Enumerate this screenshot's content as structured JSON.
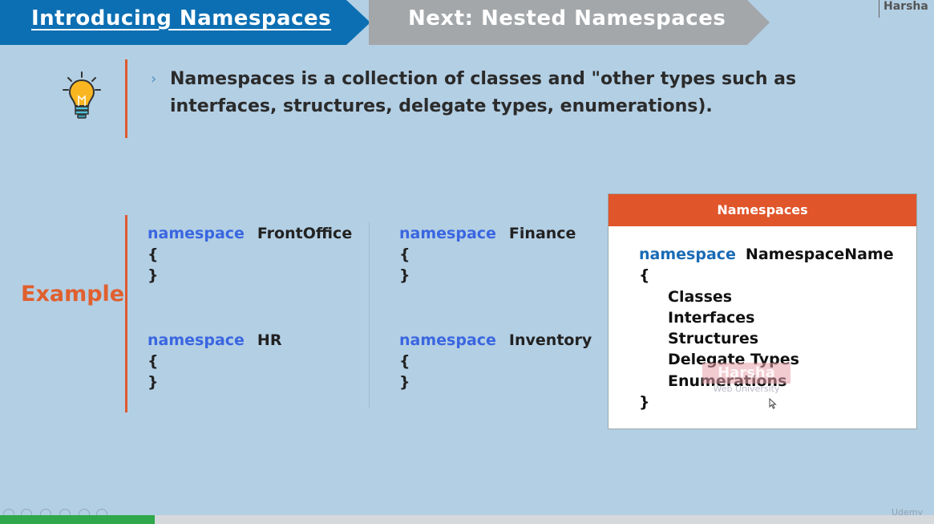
{
  "header": {
    "current_title": "Introducing Namespaces",
    "next_title": "Next: Nested Namespaces",
    "author": "Harsha"
  },
  "intro": {
    "text": "Namespaces is a collection of classes and \"other types such as interfaces, structures, delegate types, enumerations)."
  },
  "example": {
    "label": "Example",
    "keyword": "namespace",
    "blocks": [
      {
        "name": "FrontOffice",
        "open": "{",
        "close": "}"
      },
      {
        "name": "Finance",
        "open": "{",
        "close": "}"
      },
      {
        "name": "HR",
        "open": "{",
        "close": "}"
      },
      {
        "name": "Inventory",
        "open": "{",
        "close": "}"
      }
    ]
  },
  "syntax_box": {
    "title": "Namespaces",
    "keyword": "namespace",
    "name": "NamespaceName",
    "open": "{",
    "items": [
      "Classes",
      "Interfaces",
      "Structures",
      "Delegate Types",
      "Enumerations"
    ],
    "close": "}"
  },
  "watermark": {
    "brand": "Harsha",
    "sub": "Web University"
  },
  "player": {
    "progress": 0.166,
    "brand": "Udemy"
  },
  "colors": {
    "active_header": "#0c6fb3",
    "inactive_header": "#a3a7aa",
    "accent": "#e0602f",
    "keyword": "#3a66e0",
    "background": "#b3cfe4",
    "progress": "#2ea84a"
  },
  "icons": [
    "lightbulb-icon",
    "chevron-right-icon",
    "mouse-cursor-icon"
  ]
}
